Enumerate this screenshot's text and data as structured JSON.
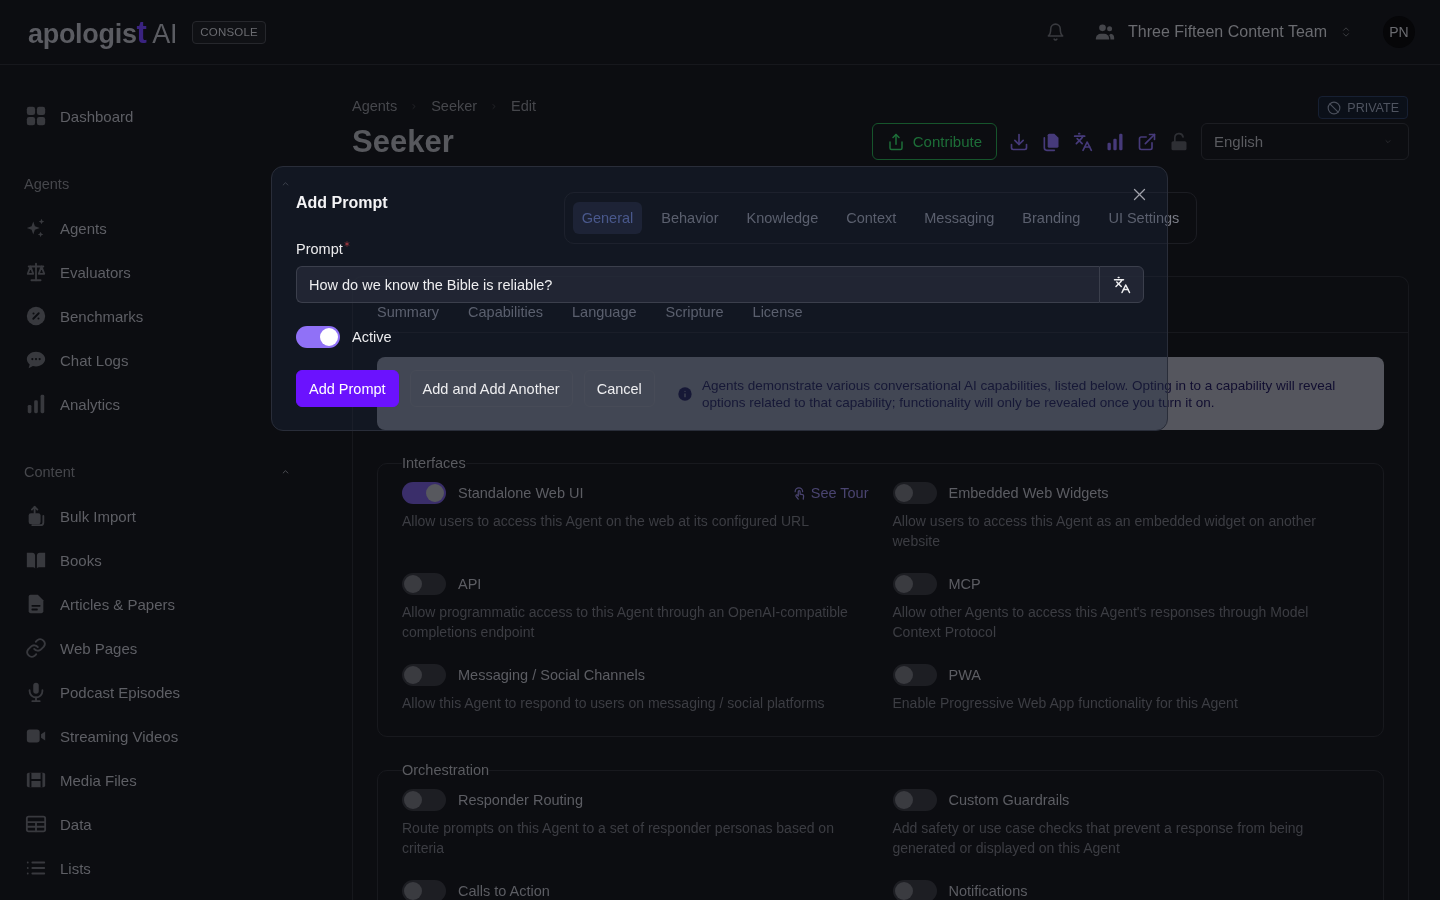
{
  "header": {
    "logo": "apologist AI",
    "badge": "CONSOLE",
    "team": "Three Fifteen Content Team",
    "avatar": "PN"
  },
  "sidebar": {
    "sections": [
      {
        "items": [
          {
            "label": "Dashboard"
          }
        ]
      },
      {
        "title": "Agents",
        "expanded": true,
        "items": [
          {
            "label": "Agents"
          },
          {
            "label": "Evaluators"
          },
          {
            "label": "Benchmarks"
          },
          {
            "label": "Chat Logs"
          },
          {
            "label": "Analytics"
          }
        ]
      },
      {
        "title": "Content",
        "expanded": true,
        "items": [
          {
            "label": "Bulk Import"
          },
          {
            "label": "Books"
          },
          {
            "label": "Articles & Papers"
          },
          {
            "label": "Web Pages"
          },
          {
            "label": "Podcast Episodes"
          },
          {
            "label": "Streaming Videos"
          },
          {
            "label": "Media Files"
          },
          {
            "label": "Data"
          },
          {
            "label": "Lists"
          }
        ]
      }
    ]
  },
  "page": {
    "breadcrumb": [
      "Agents",
      "Seeker",
      "Edit"
    ],
    "title": "Seeker",
    "visibility": "PRIVATE",
    "contribute": "Contribute",
    "language": "English",
    "tabs": [
      {
        "label": "General",
        "selected": true
      },
      {
        "label": "Behavior",
        "selected": false
      },
      {
        "label": "Knowledge",
        "selected": false
      },
      {
        "label": "Context",
        "selected": false
      },
      {
        "label": "Messaging",
        "selected": false
      },
      {
        "label": "Branding",
        "selected": false
      },
      {
        "label": "UI Settings",
        "selected": false
      }
    ],
    "subtabs": [
      "Summary",
      "Capabilities",
      "Language",
      "Scripture",
      "License"
    ],
    "notice": "Agents demonstrate various conversational AI capabilities, listed below. Opting in to a capability will reveal options related to that capability; functionality will only be revealed once you turn it on.",
    "groups": [
      {
        "title": "Interfaces",
        "options": [
          {
            "label": "Standalone Web UI",
            "on": true,
            "link": "See Tour",
            "description": "Allow users to access this Agent on the web at its configured URL"
          },
          {
            "label": "Embedded Web Widgets",
            "on": false,
            "description": "Allow users to access this Agent as an embedded widget on another website"
          },
          {
            "label": "API",
            "on": false,
            "description": "Allow programmatic access to this Agent through an OpenAI-compatible completions endpoint"
          },
          {
            "label": "MCP",
            "on": false,
            "description": "Allow other Agents to access this Agent's responses through Model Context Protocol"
          },
          {
            "label": "Messaging / Social Channels",
            "on": false,
            "description": "Allow this Agent to respond to users on messaging / social platforms"
          },
          {
            "label": "PWA",
            "on": false,
            "description": "Enable Progressive Web App functionality for this Agent"
          }
        ]
      },
      {
        "title": "Orchestration",
        "options": [
          {
            "label": "Responder Routing",
            "on": false,
            "description": "Route prompts on this Agent to a set of responder personas based on criteria"
          },
          {
            "label": "Custom Guardrails",
            "on": false,
            "description": "Add safety or use case checks that prevent a response from being generated or displayed on this Agent"
          },
          {
            "label": "Calls to Action",
            "on": false
          },
          {
            "label": "Notifications",
            "on": false
          }
        ]
      }
    ]
  },
  "modal": {
    "title": "Add Prompt",
    "field": {
      "label": "Prompt",
      "required": true,
      "value": "How do we know the Bible is reliable?"
    },
    "active": {
      "label": "Active",
      "on": true
    },
    "buttons": [
      {
        "label": "Add Prompt",
        "kind": "primary"
      },
      {
        "label": "Add and Add Another",
        "kind": "secondary"
      },
      {
        "label": "Cancel",
        "kind": "secondary"
      }
    ]
  }
}
